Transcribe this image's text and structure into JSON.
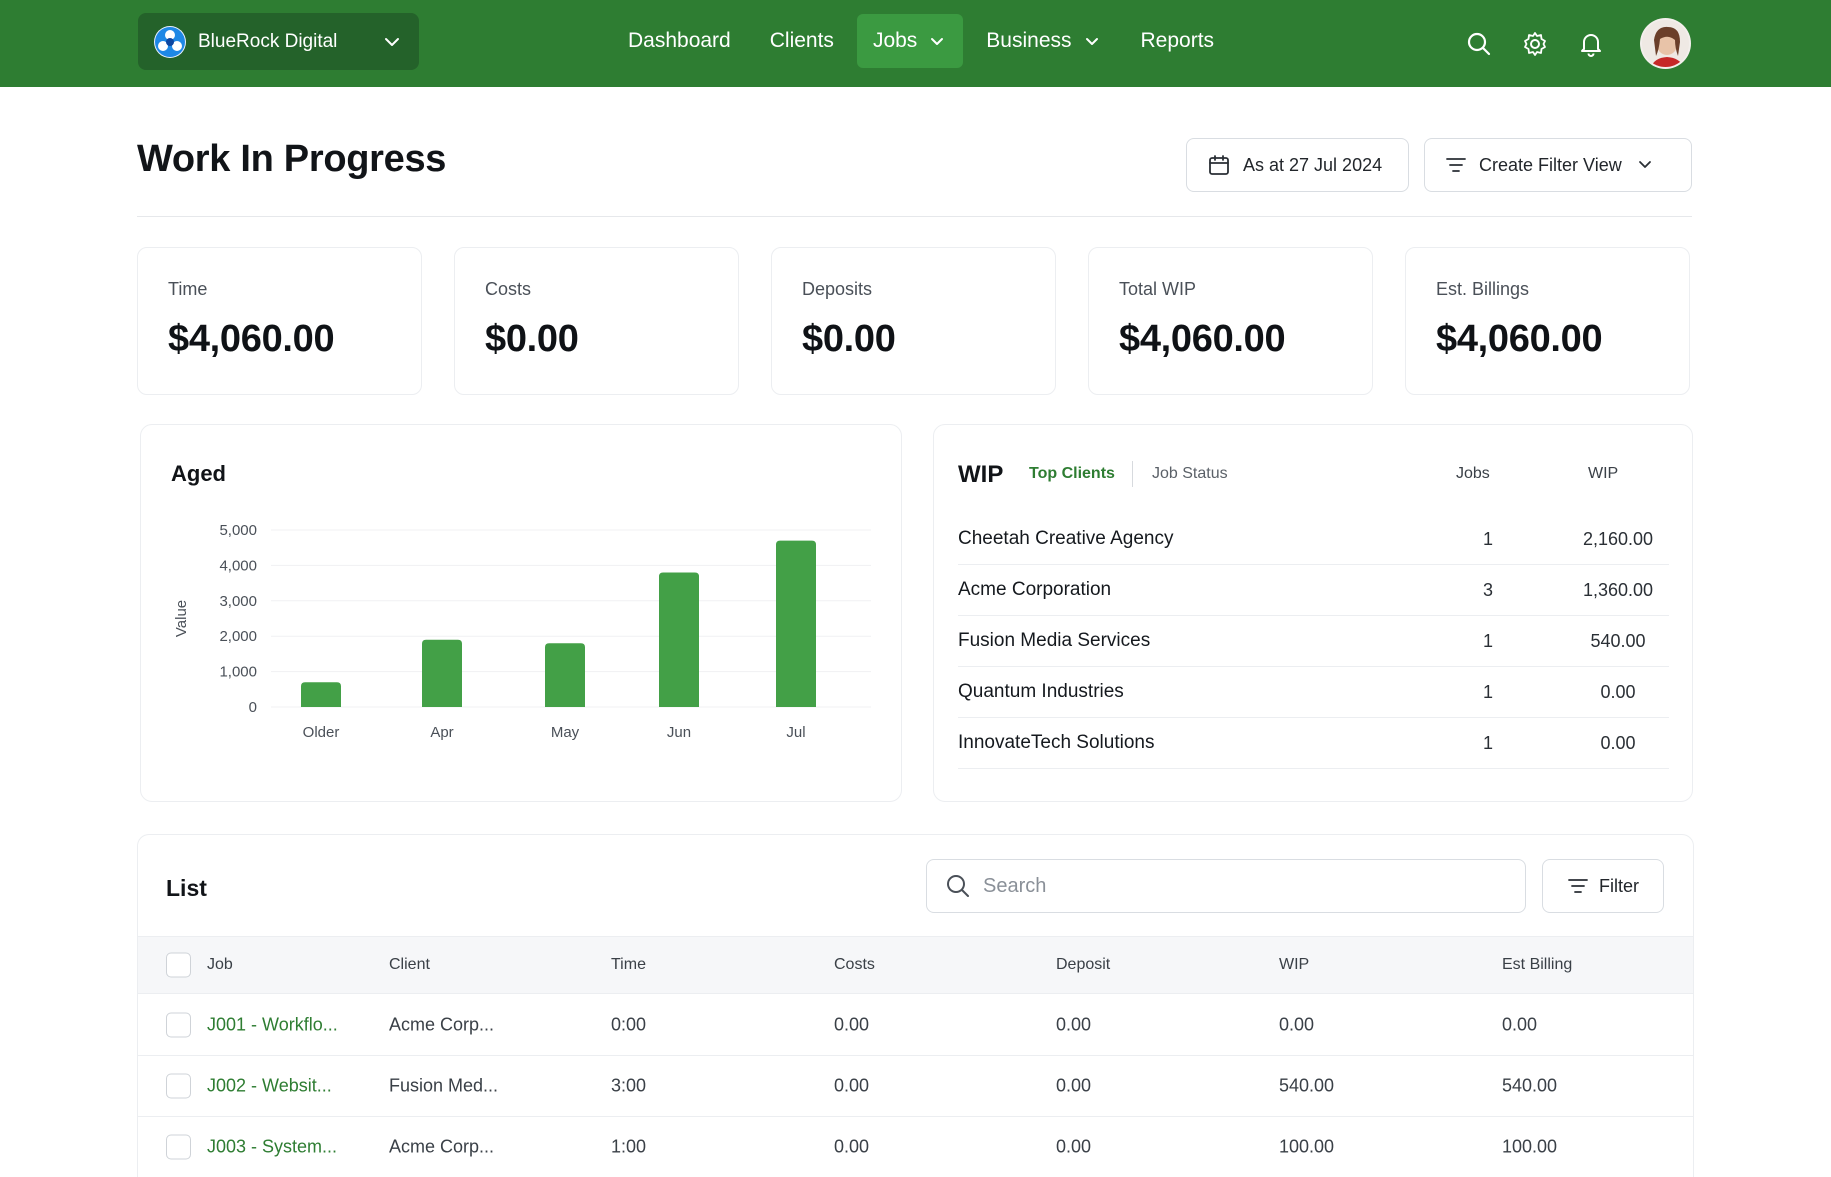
{
  "nav": {
    "org_name": "BlueRock Digital",
    "links": [
      {
        "label": "Dashboard"
      },
      {
        "label": "Clients"
      },
      {
        "label": "Jobs"
      },
      {
        "label": "Business"
      },
      {
        "label": "Reports"
      }
    ],
    "active": "Jobs",
    "icons": [
      "search-icon",
      "gear-icon",
      "bell-icon"
    ]
  },
  "header": {
    "title": "Work In Progress",
    "date_button": "As at 27 Jul 2024",
    "filter_view_button": "Create Filter View"
  },
  "stats": [
    {
      "label": "Time",
      "value": "$4,060.00"
    },
    {
      "label": "Costs",
      "value": "$0.00"
    },
    {
      "label": "Deposits",
      "value": "$0.00"
    },
    {
      "label": "Total WIP",
      "value": "$4,060.00"
    },
    {
      "label": "Est. Billings",
      "value": "$4,060.00"
    }
  ],
  "aged": {
    "title": "Aged"
  },
  "chart_data": {
    "type": "bar",
    "categories": [
      "Older",
      "Apr",
      "May",
      "Jun",
      "Jul"
    ],
    "values": [
      700,
      1900,
      1800,
      3800,
      4700
    ],
    "ylabel": "Value",
    "xlabel": "",
    "ylim": [
      0,
      5000
    ],
    "yticks": [
      0,
      1000,
      2000,
      3000,
      4000,
      5000
    ],
    "ytick_labels": [
      "0",
      "1,000",
      "2,000",
      "3,000",
      "4,000",
      "5,000"
    ],
    "grid": true,
    "color": "#43a047"
  },
  "wip": {
    "title": "WIP",
    "tab_top_clients": "Top Clients",
    "tab_job_status": "Job Status",
    "col_jobs": "Jobs",
    "col_wip": "WIP",
    "rows": [
      {
        "client": "Cheetah Creative Agency",
        "jobs": "1",
        "wip": "2,160.00"
      },
      {
        "client": "Acme Corporation",
        "jobs": "3",
        "wip": "1,360.00"
      },
      {
        "client": "Fusion Media Services",
        "jobs": "1",
        "wip": "540.00"
      },
      {
        "client": "Quantum Industries",
        "jobs": "1",
        "wip": "0.00"
      },
      {
        "client": "InnovateTech Solutions",
        "jobs": "1",
        "wip": "0.00"
      }
    ]
  },
  "list": {
    "title": "List",
    "search_placeholder": "Search",
    "filter_button": "Filter",
    "columns": {
      "job": "Job",
      "client": "Client",
      "time": "Time",
      "costs": "Costs",
      "deposit": "Deposit",
      "wip": "WIP",
      "est_billing": "Est Billing"
    },
    "rows": [
      {
        "job": "J001 - Workflo...",
        "client": "Acme Corp...",
        "time": "0:00",
        "costs": "0.00",
        "deposit": "0.00",
        "wip": "0.00",
        "est_billing": "0.00"
      },
      {
        "job": "J002 - Websit...",
        "client": "Fusion Med...",
        "time": "3:00",
        "costs": "0.00",
        "deposit": "0.00",
        "wip": "540.00",
        "est_billing": "540.00"
      },
      {
        "job": "J003 - System...",
        "client": "Acme Corp...",
        "time": "1:00",
        "costs": "0.00",
        "deposit": "0.00",
        "wip": "100.00",
        "est_billing": "100.00"
      }
    ]
  },
  "colors": {
    "brand": "#2e7d32",
    "brand_dark": "#24622a",
    "active_tab": "#3b9a41",
    "bar": "#43a047"
  }
}
